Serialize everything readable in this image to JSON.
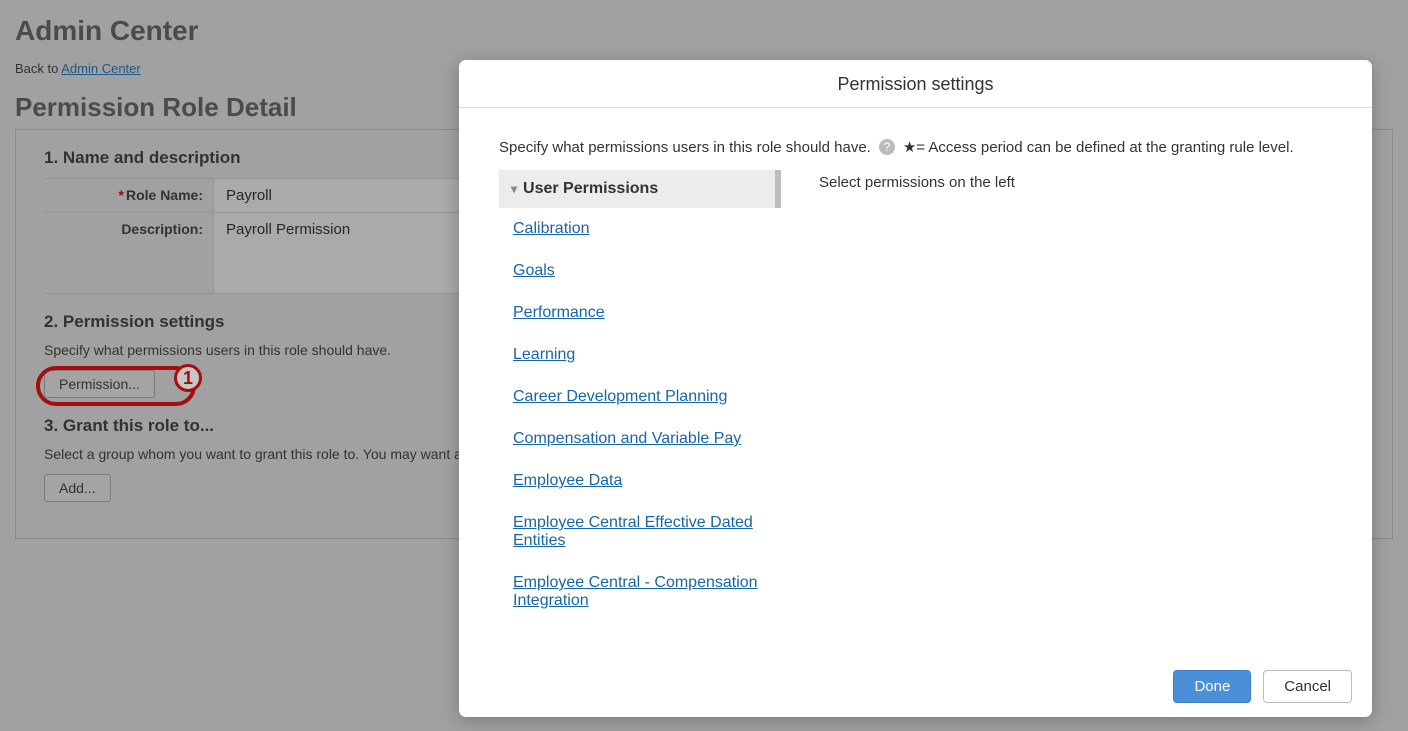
{
  "page": {
    "title": "Admin Center",
    "breadcrumb_prefix": "Back to ",
    "breadcrumb_link": "Admin Center",
    "section_title": "Permission Role Detail"
  },
  "steps": {
    "step1": {
      "title": "1. Name and description",
      "role_name_label": "Role Name:",
      "role_name_value": "Payroll",
      "description_label": "Description:",
      "description_value": "Payroll Permission"
    },
    "step2": {
      "title": "2. Permission settings",
      "desc": "Specify what permissions users in this role should have.",
      "button_label": "Permission..."
    },
    "step3": {
      "title": "3. Grant this role to...",
      "desc": "Select a group whom you want to grant this role to. You may want a group of people to manage permission for self or others such as the group of \"HR Department\" to manage permissions to their own dep",
      "button_label": "Add..."
    }
  },
  "callout": {
    "number": "1"
  },
  "dialog": {
    "title": "Permission settings",
    "instruction_a": "Specify what permissions users in this role should have.",
    "instruction_b": "★= Access period can be defined at the granting rule level.",
    "tree": {
      "header": "User Permissions",
      "items": [
        "Calibration",
        "Goals",
        "Performance",
        "Learning",
        "Career Development Planning",
        "Compensation and Variable Pay",
        "Employee Data",
        "Employee Central Effective Dated Entities",
        "Employee Central - Compensation Integration"
      ]
    },
    "detail_placeholder": "Select permissions on the left",
    "done_label": "Done",
    "cancel_label": "Cancel"
  }
}
